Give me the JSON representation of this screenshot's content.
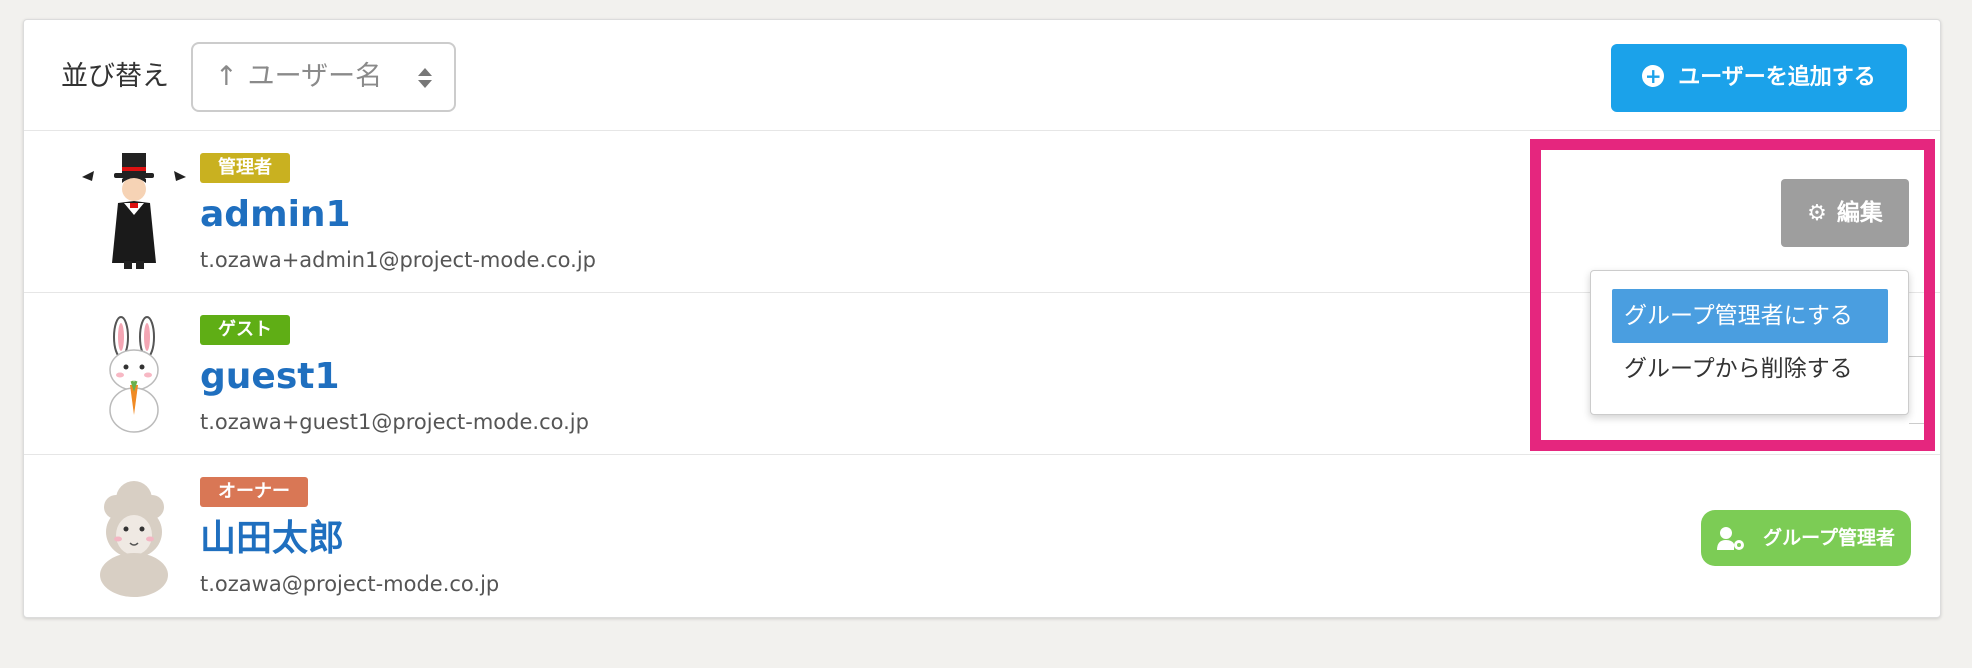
{
  "sort": {
    "label": "並び替え",
    "arrow": "↑",
    "value": "ユーザー名"
  },
  "toolbar": {
    "add_user_label": "ユーザーを追加する"
  },
  "users": [
    {
      "role": "管理者",
      "role_color": "#c9b120",
      "name": "admin1",
      "email": "t.ozawa+admin1@project-mode.co.jp",
      "avatar": "magician-avatar",
      "action_label": "編集"
    },
    {
      "role": "ゲスト",
      "role_color": "#5fae15",
      "name": "guest1",
      "email": "t.ozawa+guest1@project-mode.co.jp",
      "avatar": "rabbit-avatar"
    },
    {
      "role": "オーナー",
      "role_color": "#d97755",
      "name": "山田太郎",
      "email": "t.ozawa@project-mode.co.jp",
      "avatar": "alpaca-avatar",
      "action_label": "グループ管理者"
    }
  ],
  "dropdown": {
    "items": [
      "グループ管理者にする",
      "グループから削除する"
    ]
  },
  "colors": {
    "accent": "#1ba2ea",
    "highlight": "#e5267e",
    "name_link": "#1f6fbf"
  }
}
